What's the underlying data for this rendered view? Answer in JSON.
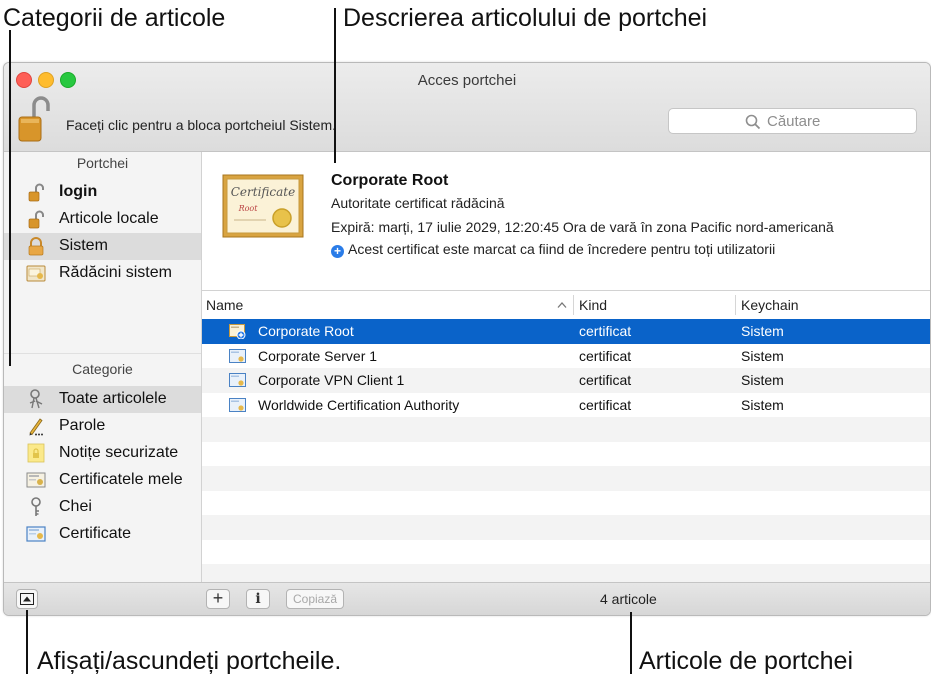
{
  "callouts": {
    "categories": "Categorii de articole",
    "description": "Descrierea articolului de portchei",
    "toggle": "Afișați/ascundeți portcheile.",
    "items": "Articole de portchei"
  },
  "window": {
    "title": "Acces portchei",
    "lock_message": "Faceți clic pentru a bloca portcheiul Sistem.",
    "search_placeholder": "Căutare"
  },
  "sidebar": {
    "keychains_header": "Portchei",
    "keychains": [
      {
        "label": "login",
        "icon": "unlocked-lock-icon"
      },
      {
        "label": "Articole locale",
        "icon": "unlocked-lock-icon"
      },
      {
        "label": "Sistem",
        "icon": "lock-icon",
        "selected": true
      },
      {
        "label": "Rădăcini sistem",
        "icon": "certificate-folder-icon"
      }
    ],
    "category_header": "Categorie",
    "categories": [
      {
        "label": "Toate articolele",
        "icon": "all-items-icon",
        "selected": true
      },
      {
        "label": "Parole",
        "icon": "pencil-icon"
      },
      {
        "label": "Notițe securizate",
        "icon": "secure-note-icon"
      },
      {
        "label": "Certificatele mele",
        "icon": "my-certificate-icon"
      },
      {
        "label": "Chei",
        "icon": "key-icon"
      },
      {
        "label": "Certificate",
        "icon": "certificate-icon"
      }
    ]
  },
  "detail": {
    "image_text": "Certificate",
    "image_subtext": "Root",
    "name": "Corporate Root",
    "subtitle": "Autoritate certificat rădăcină",
    "expires": "Expiră: marți, 17 iulie 2029, 12:20:45 Ora de vară în zona Pacific nord-americană",
    "trust": "Acest certificat este marcat ca fiind de încredere pentru toți utilizatorii"
  },
  "table": {
    "headers": {
      "name": "Name",
      "kind": "Kind",
      "keychain": "Keychain"
    },
    "rows": [
      {
        "name": "Corporate Root",
        "kind": "certificat",
        "keychain": "Sistem",
        "selected": true
      },
      {
        "name": "Corporate Server 1",
        "kind": "certificat",
        "keychain": "Sistem"
      },
      {
        "name": "Corporate VPN Client 1",
        "kind": "certificat",
        "keychain": "Sistem"
      },
      {
        "name": "Worldwide Certification Authority",
        "kind": "certificat",
        "keychain": "Sistem"
      }
    ]
  },
  "bottombar": {
    "add_label": "+",
    "info_label": "i",
    "copy_label": "Copiază",
    "count": "4 articole"
  },
  "colors": {
    "selection": "#0a63c9",
    "sidebar_selection": "#dcdcdc",
    "trust_blue": "#2a7ce8"
  }
}
